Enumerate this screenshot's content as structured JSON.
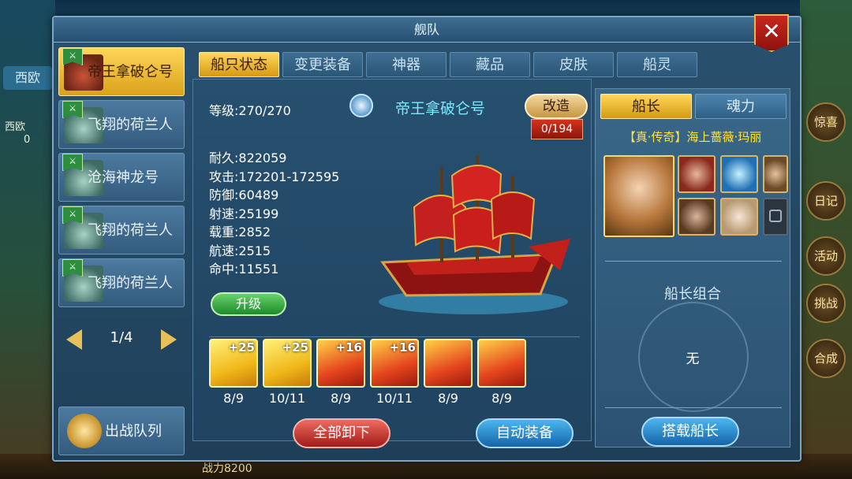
{
  "window": {
    "title": "舰队"
  },
  "ships": [
    {
      "name": "帝王拿破仑号",
      "active": true
    },
    {
      "name": "飞翔的荷兰人",
      "active": false
    },
    {
      "name": "沧海神龙号",
      "active": false
    },
    {
      "name": "飞翔的荷兰人",
      "active": false
    },
    {
      "name": "飞翔的荷兰人",
      "active": false
    }
  ],
  "pager": {
    "label": "1/4"
  },
  "battle_queue": {
    "label": "出战队列"
  },
  "tabs": [
    "船只状态",
    "变更装备",
    "神器",
    "藏品",
    "皮肤",
    "船灵"
  ],
  "ship": {
    "level": "等级:270/270",
    "name": "帝王拿破仑号",
    "refit_label": "改造",
    "refit_count": "0/194",
    "stats": [
      "耐久:822059",
      "攻击:172201-172595",
      "防御:60489",
      "射速:25199",
      "载重:2852",
      "航速:2515",
      "命中:11551"
    ],
    "upgrade_label": "升级"
  },
  "equipment": [
    {
      "name": "炮-icon",
      "plus": "+25",
      "qty": "8/9"
    },
    {
      "name": "cannon-icon",
      "plus": "+25",
      "qty": "10/11"
    },
    {
      "name": "sail-icon",
      "plus": "+16",
      "qty": "8/9"
    },
    {
      "name": "cannonball-icon",
      "plus": "+16",
      "qty": "10/11"
    },
    {
      "name": "gate-icon",
      "plus": "",
      "qty": "8/9"
    },
    {
      "name": "ship-hull-icon",
      "plus": "",
      "qty": "8/9"
    }
  ],
  "actions": {
    "unload_all": "全部卸下",
    "auto_equip": "自动装备"
  },
  "captain_panel": {
    "tabs": [
      "船长",
      "魂力"
    ],
    "captain_name": "【真·传奇】海上蔷薇·玛丽",
    "combo_title": "船长组合",
    "combo_value": "无",
    "load_label": "搭载船长"
  },
  "background": {
    "left_tab": "西欧",
    "left_small": "西欧",
    "left_zero": "0",
    "right_buttons": [
      "惊喜",
      "日记",
      "活动",
      "挑战",
      "合成"
    ],
    "bottom_power": "战力8200"
  },
  "colors": {
    "accent": "#ffd75a",
    "panel": "#29516f",
    "title": "#7fe6ff",
    "captain_name": "#ffe53a"
  }
}
